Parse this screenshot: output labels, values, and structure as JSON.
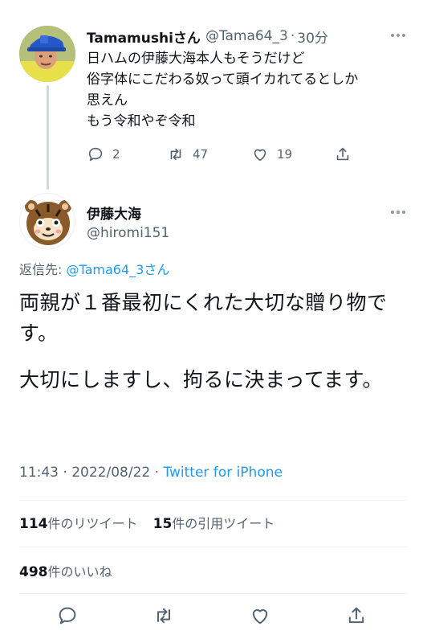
{
  "reply_tweet": {
    "display_name": "Tamamushiさん",
    "handle": "@Tama64_3",
    "separator": "·",
    "time": "30分",
    "lines": [
      "日ハムの伊藤大海本人もそうだけど",
      "俗字体にこだわる奴って頭イカれてるとしか",
      "思えん",
      "もう令和やぞ令和"
    ],
    "reply_count": "2",
    "retweet_count": "47",
    "like_count": "19"
  },
  "main_tweet": {
    "display_name": "伊藤大海",
    "handle": "@hiromi151",
    "reply_to_prefix": "返信先: ",
    "reply_to_handle": "@Tama64_3さん",
    "paragraphs": [
      "両親が１番最初にくれた大切な贈り物です。",
      "大切にしますし、拘るに決まってます。"
    ],
    "time": "11:43",
    "date": "2022/08/22",
    "meta_separator": " · ",
    "source": "Twitter for iPhone",
    "retweets_count": "114",
    "retweets_label": "件のリツイート",
    "quotes_count": "15",
    "quotes_label": "件の引用ツイート",
    "likes_count": "498",
    "likes_label": "件のいいね"
  },
  "colors": {
    "link": "#1d9bf0",
    "secondary_text": "#536471",
    "divider": "#eff3f4"
  }
}
